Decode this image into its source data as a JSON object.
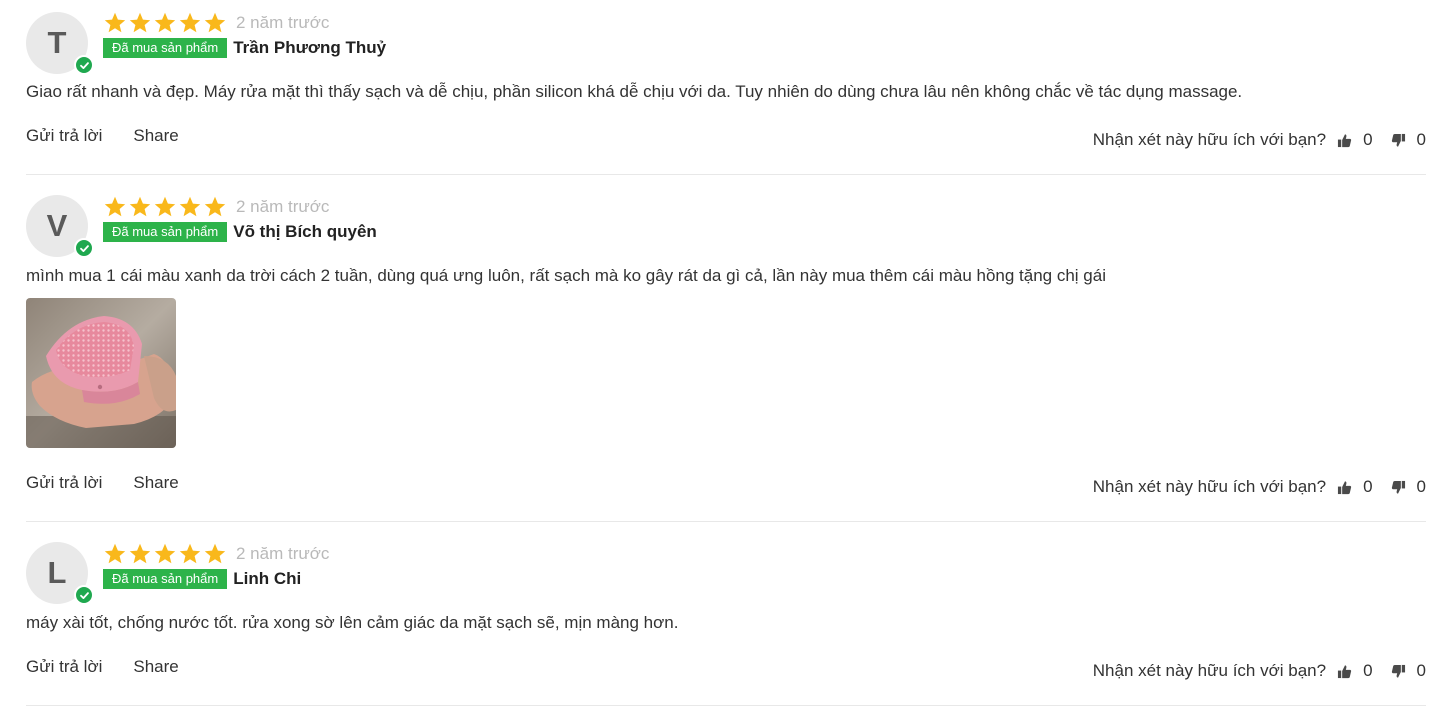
{
  "reviews": [
    {
      "initial": "T",
      "time": "2 năm trước",
      "badge": "Đã mua sản phẩm",
      "name": "Trần Phương Thuỷ",
      "text": "Giao rất nhanh và đẹp. Máy rửa mặt thì thấy sạch và dễ chịu, phần silicon khá dễ chịu với da. Tuy nhiên do dùng chưa lâu nên không chắc về tác dụng massage.",
      "reply_label": "Gửi trả lời",
      "share_label": "Share",
      "helpful_question": "Nhận xét này hữu ích với bạn?",
      "likes": "0",
      "dislikes": "0",
      "rating": 5
    },
    {
      "initial": "V",
      "time": "2 năm trước",
      "badge": "Đã mua sản phẩm",
      "name": "Võ thị Bích quyên",
      "text": "mình mua 1 cái màu xanh da trời cách 2 tuần, dùng quá ưng luôn, rất sạch mà ko gây rát da gì cả, lần này mua thêm cái màu hồng tặng chị gái",
      "reply_label": "Gửi trả lời",
      "share_label": "Share",
      "helpful_question": "Nhận xét này hữu ích với bạn?",
      "likes": "0",
      "dislikes": "0",
      "rating": 5
    },
    {
      "initial": "L",
      "time": "2 năm trước",
      "badge": "Đã mua sản phẩm",
      "name": "Linh Chi",
      "text": "máy xài tốt, chống nước tốt. rửa xong sờ lên cảm giác da mặt sạch sẽ, mịn màng hơn.",
      "reply_label": "Gửi trả lời",
      "share_label": "Share",
      "helpful_question": "Nhận xét này hữu ích với bạn?",
      "likes": "0",
      "dislikes": "0",
      "rating": 5
    }
  ],
  "colors": {
    "star": "#f9b81b",
    "badge": "#2db34a",
    "verified": "#1fa84f",
    "time": "#b9b9b9"
  }
}
